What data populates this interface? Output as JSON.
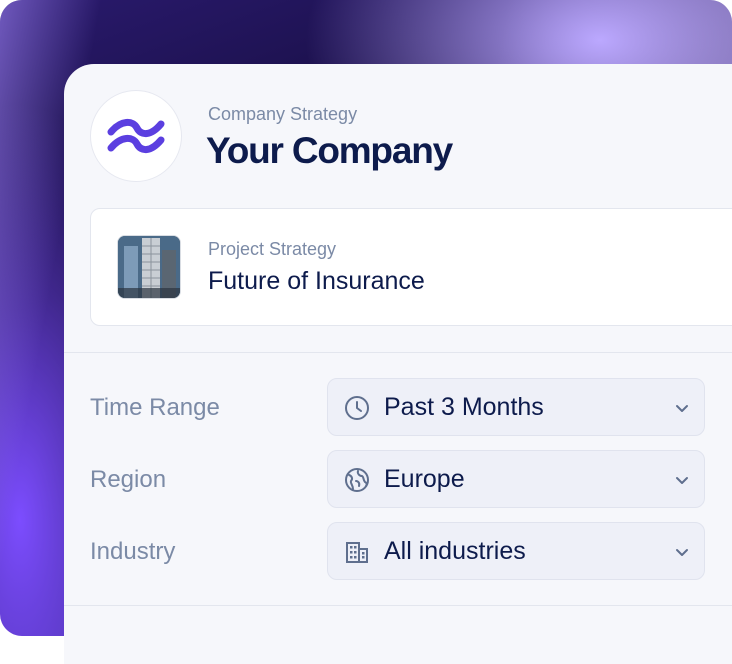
{
  "company": {
    "kicker": "Company Strategy",
    "name": "Your Company"
  },
  "project": {
    "kicker": "Project Strategy",
    "name": "Future of Insurance"
  },
  "filters": [
    {
      "label": "Time Range",
      "value": "Past 3 Months",
      "icon": "clock-icon"
    },
    {
      "label": "Region",
      "value": "Europe",
      "icon": "globe-icon"
    },
    {
      "label": "Industry",
      "value": "All industries",
      "icon": "building-icon"
    }
  ],
  "colors": {
    "brand": "#5b3fe0",
    "text_primary": "#0d1b4c",
    "text_muted": "#7b8aa6",
    "select_bg": "#eef0f8"
  }
}
